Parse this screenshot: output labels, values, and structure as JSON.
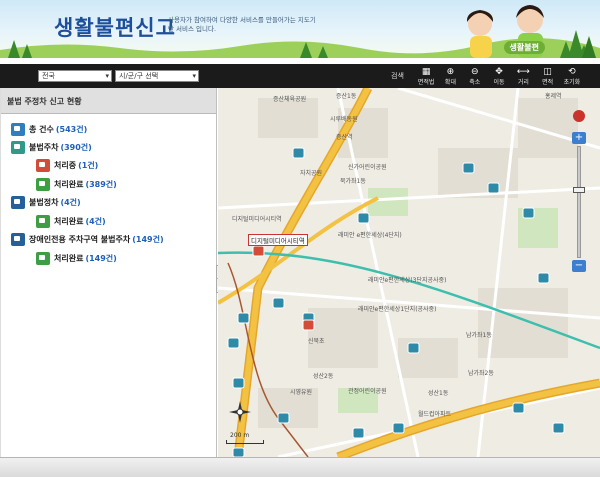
{
  "header": {
    "title": "생활불편신고",
    "subtitle": "사용자가 참여하여 다양한 서비스를 만들어가는 지도기반 서비스 입니다.",
    "stamp": "생활불편"
  },
  "toolbar": {
    "region_select": "전국",
    "district_select": "시/군/구 선택",
    "search_label": "검색",
    "tools": [
      {
        "label": "면적법",
        "icon": "area-measure-icon",
        "glyph": "▦"
      },
      {
        "label": "확대",
        "icon": "zoom-in-icon",
        "glyph": "⊕"
      },
      {
        "label": "축소",
        "icon": "zoom-out-icon",
        "glyph": "⊖"
      },
      {
        "label": "이동",
        "icon": "pan-icon",
        "glyph": "✥"
      },
      {
        "label": "거리",
        "icon": "distance-icon",
        "glyph": "⟷"
      },
      {
        "label": "면적",
        "icon": "area-icon",
        "glyph": "◫"
      },
      {
        "label": "초기화",
        "icon": "reset-icon",
        "glyph": "⟲"
      }
    ]
  },
  "panel": {
    "title": "불법 주정차 신고 현황",
    "items": [
      {
        "label": "총 건수",
        "count": "(543건)",
        "icon": "total-icon",
        "color": "blue"
      },
      {
        "label": "불법주차",
        "count": "(390건)",
        "icon": "illegal-parking-icon",
        "color": "teal"
      },
      {
        "label": "처리중",
        "count": "(1건)",
        "icon": "processing-icon",
        "color": "red"
      },
      {
        "label": "처리완료",
        "count": "(389건)",
        "icon": "completed-icon",
        "color": "green"
      },
      {
        "label": "불법정차",
        "count": "(4건)",
        "icon": "illegal-stopping-icon",
        "color": "navy"
      },
      {
        "label": "처리완료",
        "count": "(4건)",
        "icon": "completed-icon",
        "color": "green"
      },
      {
        "label": "장애인전용 주차구역 불법주차",
        "count": "(149건)",
        "icon": "disabled-parking-icon",
        "color": "navy"
      },
      {
        "label": "처리완료",
        "count": "(149건)",
        "icon": "completed-icon",
        "color": "green"
      }
    ]
  },
  "map": {
    "highlight_label": "디지털미디어시티역",
    "labels": [
      "증산체육공원",
      "증산1동",
      "시루배동원",
      "증산역",
      "자치공원",
      "신가어린이공원",
      "북가좌1동",
      "디지털미디어시티역",
      "래미안 e편한세상(4단지)",
      "래미안e편한세상(3단지공사중)",
      "래미안e편한세상1단지(공사중)",
      "남가좌1동",
      "신북초",
      "성산2동",
      "시영유원",
      "관정어린이공원",
      "성산1동",
      "월드컵아파트",
      "홍제역",
      "남가좌2동"
    ],
    "scale": "200 m"
  },
  "colors": {
    "title": "#1e4f9c",
    "toolbar_bg": "#1b1b1b",
    "count_text": "#1f5fb8",
    "road_major": "#f3c243",
    "rail": "#3dbfae"
  }
}
